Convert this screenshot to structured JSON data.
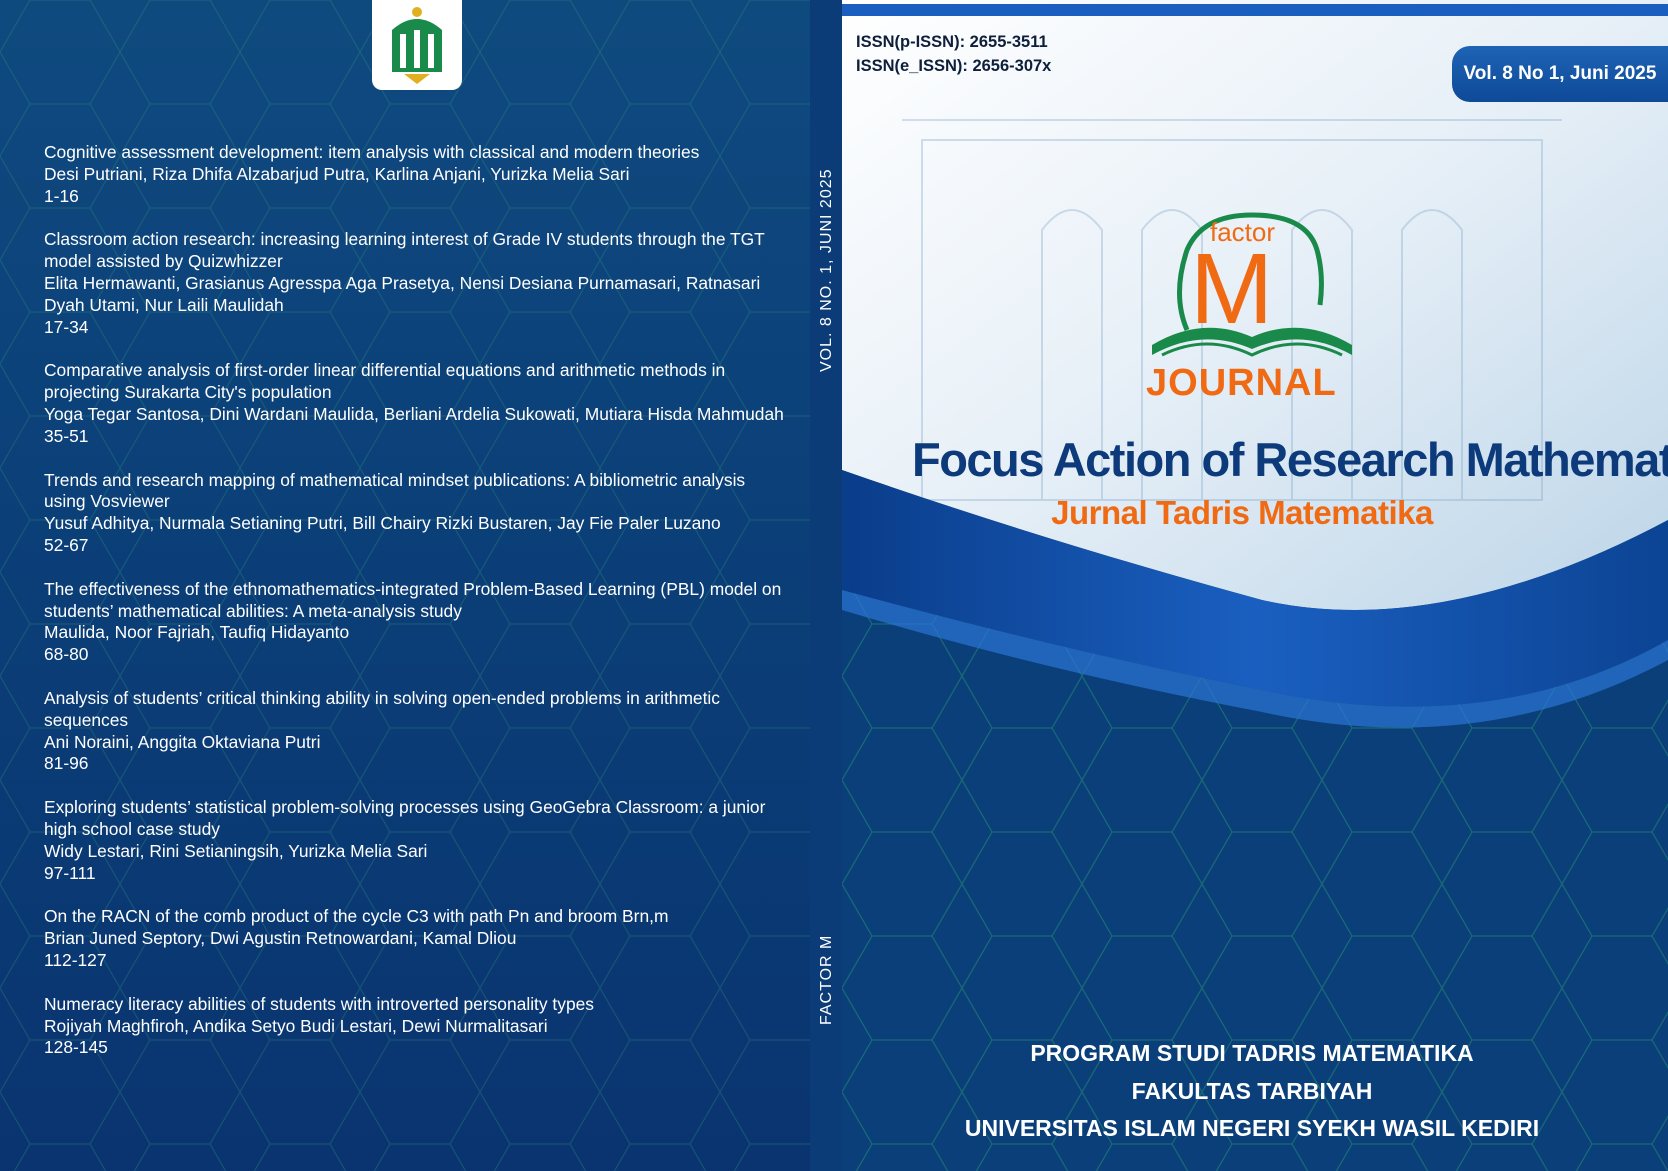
{
  "colors": {
    "navy": "#0b3f78",
    "title_blue": "#0c3a7a",
    "orange": "#f06a14",
    "logo_green": "#1a8a4a"
  },
  "back_cover": {
    "logo_icon": "university-emblem-icon",
    "articles": [
      {
        "title": "Cognitive assessment development: item analysis with classical and modern theories",
        "authors": "Desi Putriani, Riza Dhifa Alzabarjud Putra, Karlina Anjani, Yurizka Melia Sari",
        "pages": "1-16"
      },
      {
        "title": "Classroom action research: increasing learning interest of Grade IV students through the TGT model assisted by Quizwhizzer",
        "authors": "Elita Hermawanti, Grasianus Agresspa Aga Prasetya, Nensi Desiana Purnamasari, Ratnasari Dyah Utami, Nur Laili Maulidah",
        "pages": "17-34"
      },
      {
        "title": "Comparative analysis of first-order linear differential equations and arithmetic methods in projecting Surakarta City's population",
        "authors": "Yoga Tegar Santosa, Dini Wardani Maulida, Berliani Ardelia Sukowati, Mutiara Hisda Mahmudah",
        "pages": "35-51"
      },
      {
        "title": "Trends and research mapping of mathematical mindset publications: A bibliometric analysis using Vosviewer",
        "authors": "Yusuf Adhitya, Nurmala Setianing Putri, Bill Chairy Rizki Bustaren, Jay Fie Paler Luzano",
        "pages": "52-67"
      },
      {
        "title": "The effectiveness of the ethnomathematics-integrated Problem-Based Learning (PBL) model on students’ mathematical abilities: A meta-analysis study",
        "authors": "Maulida, Noor Fajriah, Taufiq Hidayanto",
        "pages": "68-80"
      },
      {
        "title": "Analysis of students’ critical thinking ability in solving open-ended problems in arithmetic sequences",
        "authors": "Ani Noraini, Anggita Oktaviana Putri",
        "pages": "81-96"
      },
      {
        "title": "Exploring students’ statistical problem-solving processes using GeoGebra Classroom: a junior high school case study",
        "authors": "Widy Lestari, Rini Setianingsih, Yurizka Melia Sari",
        "pages": "97-111"
      },
      {
        "title": "On the RACN of the comb product of the cycle C3 with path Pn  and broom Brn,m",
        "authors": "Brian Juned Septory, Dwi Agustin Retnowardani, Kamal Dliou",
        "pages": "112-127"
      },
      {
        "title": "Numeracy literacy abilities of students with introverted personality types",
        "authors": "Rojiyah Maghfiroh, Andika Setyo Budi Lestari, Dewi Nurmalitasari",
        "pages": "128-145"
      }
    ]
  },
  "spine": {
    "volume": "VOL. 8 NO. 1, JUNI 2025",
    "journal_short": "FACTOR M"
  },
  "front_cover": {
    "issn_print": "ISSN(p-ISSN): 2655-3511",
    "issn_online": "ISSN(e_ISSN): 2656-307x",
    "volume_badge": "Vol. 8 No 1, Juni 2025",
    "logo": {
      "icon": "open-book-icon",
      "small_word": "factor",
      "letter": "M",
      "word": "JOURNAL"
    },
    "title": "Focus Action of Research Mathematic",
    "subtitle": "Jurnal Tadris Matematika",
    "institution": {
      "line1": "PROGRAM STUDI TADRIS MATEMATIKA",
      "line2": "FAKULTAS TARBIYAH",
      "line3": "UNIVERSITAS ISLAM NEGERI SYEKH WASIL KEDIRI"
    }
  }
}
